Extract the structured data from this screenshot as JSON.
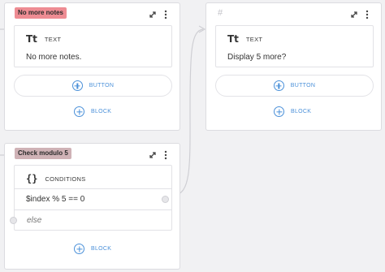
{
  "cards": {
    "no_more_notes": {
      "title": "No more notes",
      "tag_color": "#ee8c93",
      "text_step": {
        "type_label": "TEXT",
        "content": "No more notes."
      },
      "button_label": "BUTTON",
      "block_label": "BLOCK"
    },
    "unnamed": {
      "title": "#",
      "text_step": {
        "type_label": "TEXT",
        "content": "Display 5 more?"
      },
      "button_label": "BUTTON",
      "block_label": "BLOCK"
    },
    "check_modulo": {
      "title": "Check modulo 5",
      "tag_color": "#cfb2b6",
      "conditions_step": {
        "type_label": "CONDITIONS",
        "conditions": [
          "$index % 5 == 0"
        ],
        "else_label": "else"
      },
      "block_label": "BLOCK"
    }
  },
  "icons": {
    "text": "Tt",
    "conditions": "{}",
    "expand": "expand-icon",
    "menu": "more-vertical-icon",
    "add": "plus-circle-icon"
  },
  "colors": {
    "accent": "#4a90d9",
    "canvas": "#f1f1f3"
  }
}
